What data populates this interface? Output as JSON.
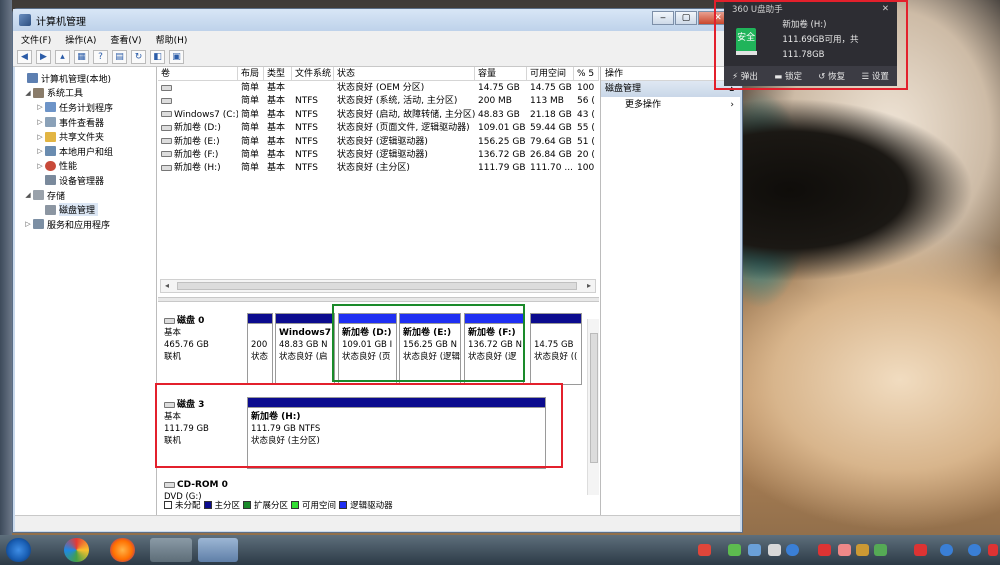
{
  "window": {
    "title": "计算机管理"
  },
  "menu": [
    "文件(F)",
    "操作(A)",
    "查看(V)",
    "帮助(H)"
  ],
  "tree": [
    {
      "label": "计算机管理(本地)",
      "level": 0,
      "arrow": ""
    },
    {
      "label": "系统工具",
      "level": 1,
      "arrow": "◢"
    },
    {
      "label": "任务计划程序",
      "level": 2,
      "arrow": "▷"
    },
    {
      "label": "事件查看器",
      "level": 2,
      "arrow": "▷"
    },
    {
      "label": "共享文件夹",
      "level": 2,
      "arrow": "▷"
    },
    {
      "label": "本地用户和组",
      "level": 2,
      "arrow": "▷"
    },
    {
      "label": "性能",
      "level": 2,
      "arrow": "▷"
    },
    {
      "label": "设备管理器",
      "level": 2,
      "arrow": ""
    },
    {
      "label": "存储",
      "level": 1,
      "arrow": "◢"
    },
    {
      "label": "磁盘管理",
      "level": 2,
      "arrow": ""
    },
    {
      "label": "服务和应用程序",
      "level": 1,
      "arrow": "▷"
    }
  ],
  "list": {
    "headers": [
      "卷",
      "布局",
      "类型",
      "文件系统",
      "状态",
      "容量",
      "可用空间",
      "% 5"
    ],
    "rows": [
      [
        "",
        "简单",
        "基本",
        "",
        "状态良好 (OEM 分区)",
        "14.75 GB",
        "14.75 GB",
        "100"
      ],
      [
        "",
        "简单",
        "基本",
        "NTFS",
        "状态良好 (系统, 活动, 主分区)",
        "200 MB",
        "113 MB",
        "56 ("
      ],
      [
        "Windows7 (C:)",
        "简单",
        "基本",
        "NTFS",
        "状态良好 (启动, 故障转储, 主分区)",
        "48.83 GB",
        "21.18 GB",
        "43 ("
      ],
      [
        "新加卷 (D:)",
        "简单",
        "基本",
        "NTFS",
        "状态良好 (页面文件, 逻辑驱动器)",
        "109.01 GB",
        "59.44 GB",
        "55 ("
      ],
      [
        "新加卷 (E:)",
        "简单",
        "基本",
        "NTFS",
        "状态良好 (逻辑驱动器)",
        "156.25 GB",
        "79.64 GB",
        "51 ("
      ],
      [
        "新加卷 (F:)",
        "简单",
        "基本",
        "NTFS",
        "状态良好 (逻辑驱动器)",
        "136.72 GB",
        "26.84 GB",
        "20 ("
      ],
      [
        "新加卷 (H:)",
        "简单",
        "基本",
        "NTFS",
        "状态良好 (主分区)",
        "111.79 GB",
        "111.70 ...",
        "100"
      ]
    ]
  },
  "disks": {
    "disk0": {
      "name": "磁盘 0",
      "type": "基本",
      "size": "465.76 GB",
      "status": "联机",
      "vols": [
        {
          "title": "",
          "l1": "200",
          "l2": "状态"
        },
        {
          "title": "Windows7",
          "l1": "48.83 GB N",
          "l2": "状态良好 (启"
        },
        {
          "title": "新加卷 (D:)",
          "l1": "109.01 GB I",
          "l2": "状态良好 (页"
        },
        {
          "title": "新加卷 (E:)",
          "l1": "156.25 GB N",
          "l2": "状态良好 (逻辑"
        },
        {
          "title": "新加卷 (F:)",
          "l1": "136.72 GB N",
          "l2": "状态良好 (逻"
        },
        {
          "title": "",
          "l1": "14.75 GB",
          "l2": "状态良好 (("
        }
      ]
    },
    "disk3": {
      "name": "磁盘 3",
      "type": "基本",
      "size": "111.79 GB",
      "status": "联机",
      "vol": {
        "title": "新加卷 (H:)",
        "l1": "111.79 GB NTFS",
        "l2": "状态良好 (主分区)"
      }
    },
    "cdrom": {
      "name": "CD-ROM 0",
      "line2": "DVD (G:)"
    }
  },
  "legend": [
    "未分配",
    "主分区",
    "扩展分区",
    "可用空间",
    "逻辑驱动器"
  ],
  "actions": {
    "header": "操作",
    "section": "磁盘管理",
    "item": "更多操作"
  },
  "popup": {
    "title": "360 U盘助手",
    "badge": "安全",
    "drive": "新加卷 (H:)",
    "space": "111.69GB可用，共111.78GB",
    "buttons": [
      "弹出",
      "锁定",
      "恢复",
      "设置"
    ]
  },
  "colors": {
    "primary": "#0b0b8e",
    "extended": "#1a8a2a",
    "free": "#33dd33",
    "logical": "#1f2ff2",
    "highlight_red": "#e3202c"
  }
}
